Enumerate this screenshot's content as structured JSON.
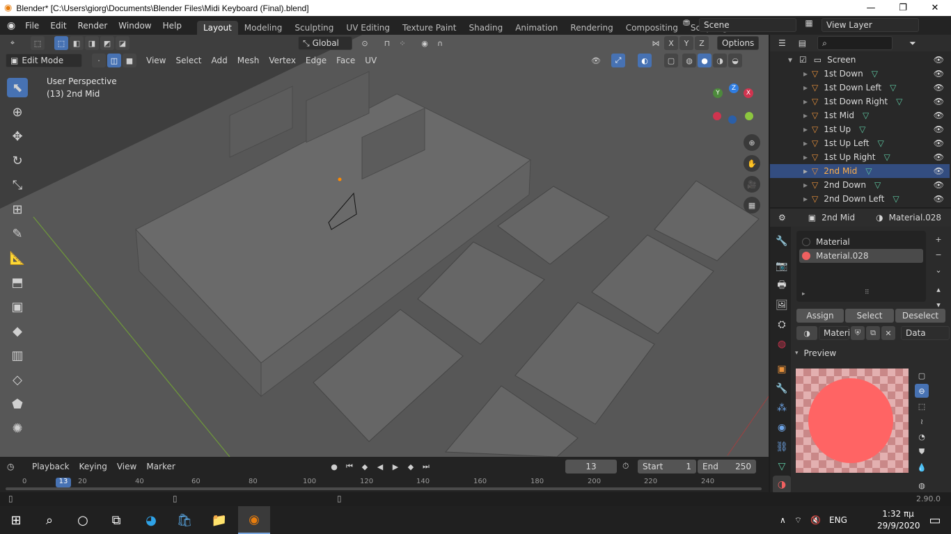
{
  "window": {
    "title": "Blender* [C:\\Users\\giorg\\Documents\\Blender Files\\Midi Keyboard (Final).blend]",
    "minimize": "—",
    "restore": "❐",
    "close": "✕"
  },
  "menus": [
    "File",
    "Edit",
    "Render",
    "Window",
    "Help"
  ],
  "workspaces": [
    "Layout",
    "Modeling",
    "Sculpting",
    "UV Editing",
    "Texture Paint",
    "Shading",
    "Animation",
    "Rendering",
    "Compositing",
    "Scripting"
  ],
  "scene": {
    "name": "Scene",
    "view_layer": "View Layer",
    "add": "+"
  },
  "viewport": {
    "mode": "Edit Mode",
    "menus": [
      "View",
      "Select",
      "Add",
      "Mesh",
      "Vertex",
      "Edge",
      "Face",
      "UV"
    ],
    "orientation": "Global",
    "options": "Options",
    "axes": [
      "X",
      "Y",
      "Z"
    ],
    "perspective": "User Perspective",
    "object_info": "(13) 2nd Mid",
    "gizmo": {
      "x": "X",
      "y": "Y",
      "z": "Z"
    }
  },
  "outliner": {
    "collection": "Screen",
    "items": [
      {
        "label": "1st Down",
        "selected": false
      },
      {
        "label": "1st Down Left",
        "selected": false
      },
      {
        "label": "1st Down Right",
        "selected": false
      },
      {
        "label": "1st Mid",
        "selected": false
      },
      {
        "label": "1st Up",
        "selected": false
      },
      {
        "label": "1st Up Left",
        "selected": false
      },
      {
        "label": "1st Up Right",
        "selected": false
      },
      {
        "label": "2nd Mid",
        "selected": true
      },
      {
        "label": "2nd Down",
        "selected": false
      },
      {
        "label": "2nd Down Left",
        "selected": false
      }
    ]
  },
  "properties": {
    "object": "2nd Mid",
    "material_header": "Material.028",
    "slots": [
      {
        "label": "Material",
        "color": "#222222",
        "selected": false
      },
      {
        "label": "Material.028",
        "color": "#f06060",
        "selected": true
      }
    ],
    "assign": "Assign",
    "select": "Select",
    "deselect": "Deselect",
    "material_field": "Materi",
    "link": "Data",
    "preview_label": "Preview"
  },
  "timeline": {
    "menus": [
      "Playback",
      "Keying",
      "View",
      "Marker"
    ],
    "current_frame": "13",
    "start_label": "Start",
    "start": "1",
    "end_label": "End",
    "end": "250",
    "ruler": [
      "0",
      "13",
      "20",
      "40",
      "60",
      "80",
      "100",
      "120",
      "140",
      "160",
      "180",
      "200",
      "220",
      "240"
    ]
  },
  "status": {
    "version": "2.90.0"
  },
  "taskbar": {
    "lang": "ENG",
    "time": "1:32 πμ",
    "date": "29/9/2020"
  },
  "colors": {
    "accent": "#4772b3",
    "selection": "#334d80",
    "material": "#ff6464",
    "outliner_object": "#e8913b",
    "mesh_data": "#5fc9a3"
  }
}
